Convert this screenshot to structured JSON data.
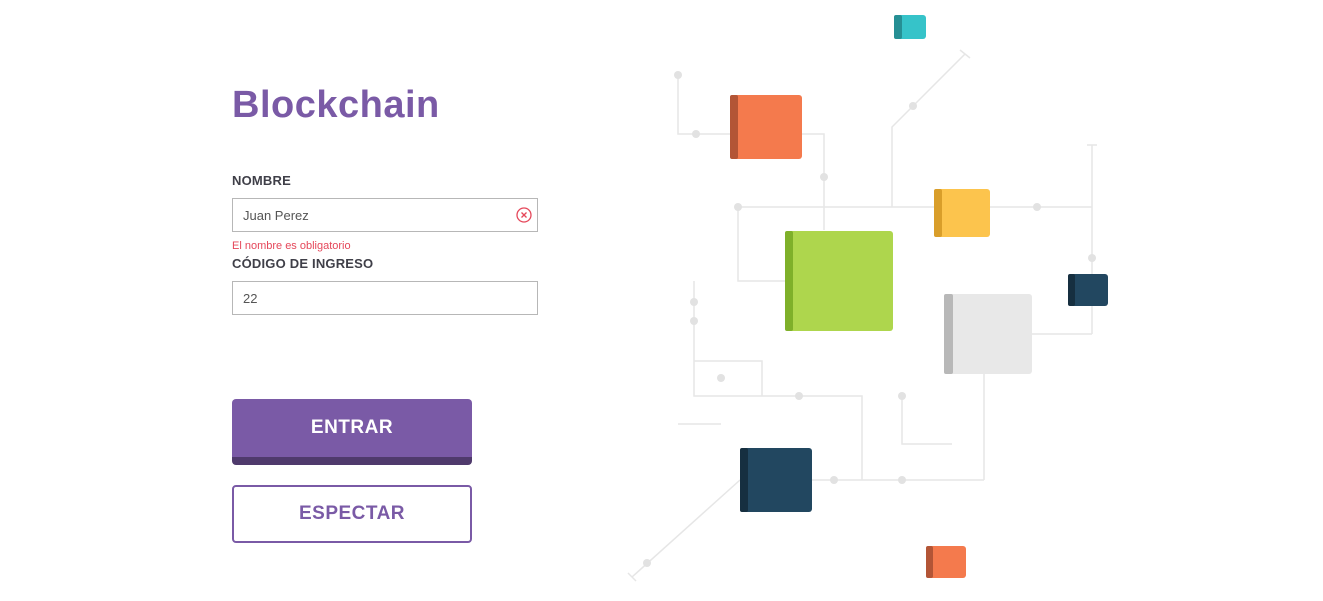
{
  "app": {
    "title": "Blockchain"
  },
  "form": {
    "name": {
      "label": "NOMBRE",
      "value": "Juan Perez",
      "error": "El nombre es obligatorio"
    },
    "code": {
      "label": "CÓDIGO DE INGRESO",
      "value": "22"
    }
  },
  "buttons": {
    "enter_label": "ENTRAR",
    "spectate_label": "ESPECTAR"
  },
  "icons": {
    "clear": "clear-circle-x-icon"
  },
  "colors": {
    "brand_purple": "#7a5aa6",
    "brand_purple_dark": "#4f3a6c",
    "error_red": "#e5475a",
    "block_orange": "#f47a4d",
    "block_green": "#aed64d",
    "block_yellow": "#fcc44d",
    "block_navy": "#224760",
    "block_teal": "#36c3c9",
    "block_gray": "#e8e8e8"
  }
}
